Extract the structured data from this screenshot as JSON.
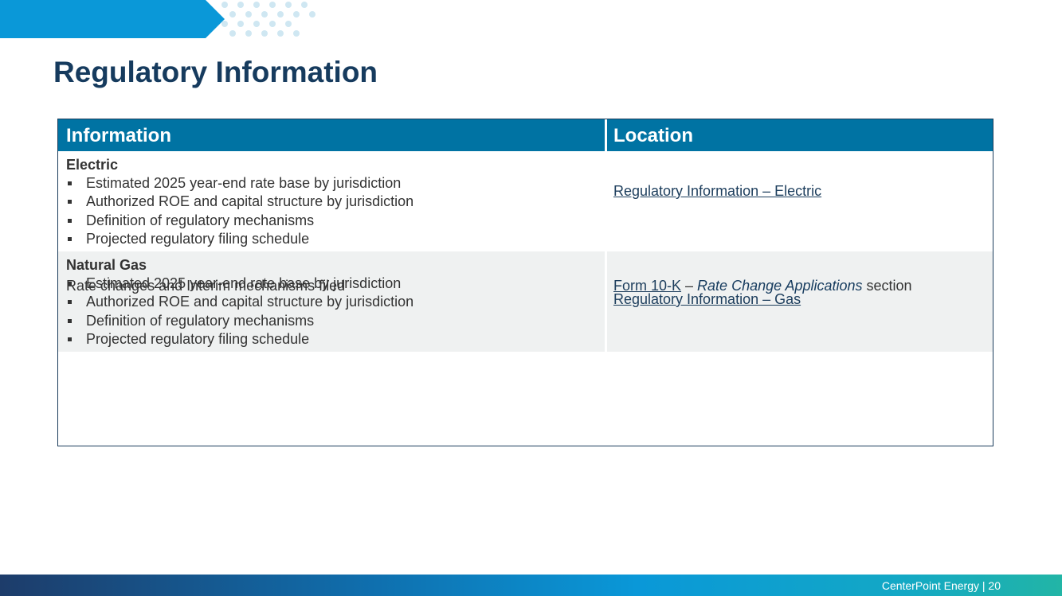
{
  "page": {
    "title": "Regulatory Information",
    "footer": "CenterPoint Energy | 20"
  },
  "table": {
    "headers": {
      "information": "Information",
      "location": "Location"
    },
    "rows": [
      {
        "title": "Electric",
        "bullets": [
          "Estimated 2025 year-end rate base by jurisdiction",
          "Authorized ROE and capital structure by jurisdiction",
          "Definition of regulatory mechanisms",
          "Projected regulatory filing schedule"
        ],
        "location_link": "Regulatory Information – Electric"
      },
      {
        "title": "Natural Gas",
        "bullets": [
          "Estimated 2025 year-end rate base by jurisdiction",
          "Authorized ROE and capital structure by jurisdiction",
          "Definition of regulatory mechanisms",
          "Projected regulatory filing schedule"
        ],
        "location_link": "Regulatory Information – Gas"
      },
      {
        "text": "Rate changes and Interim mechanisms filed",
        "location_link": "Form 10-K",
        "location_dash": " – ",
        "location_italic": "Rate Change Applications",
        "location_suffix": " section"
      }
    ]
  },
  "colors": {
    "title": "#163b5e",
    "header_bg": "#0073a3",
    "accent": "#0a98d8",
    "alt_row_bg": "#eff1f1"
  }
}
